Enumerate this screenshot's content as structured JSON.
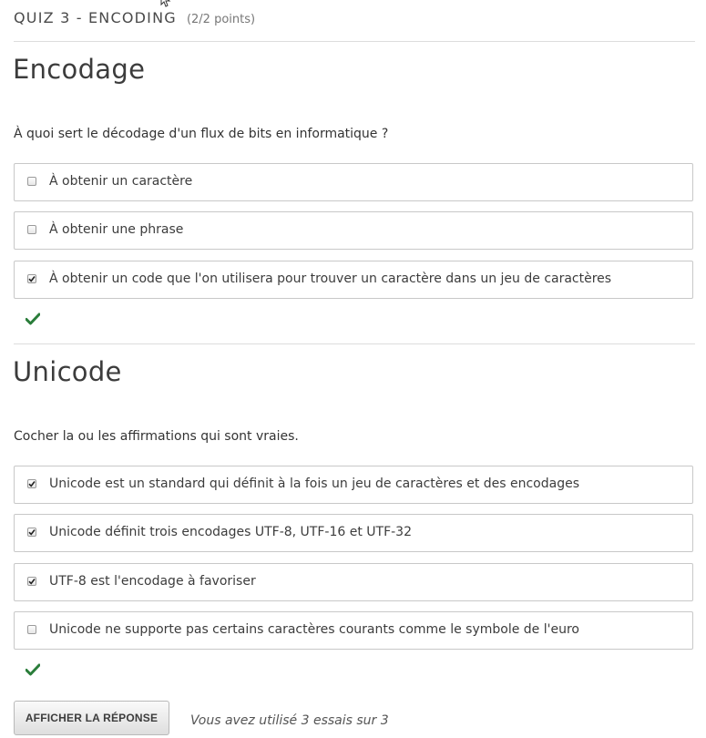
{
  "colors": {
    "correct": "#2a7d3a",
    "border": "#c8c8c8",
    "divider": "#dddddd"
  },
  "quiz": {
    "title": "QUIZ 3 - ENCODING",
    "points": "(2/2 points)"
  },
  "problems": [
    {
      "title": "Encodage",
      "question": "À quoi sert le décodage d'un flux de bits en informatique ?",
      "choices": [
        {
          "label": "À obtenir un caractère",
          "checked": false
        },
        {
          "label": "À obtenir une phrase",
          "checked": false
        },
        {
          "label": "À obtenir un code que l'on utilisera pour trouver un caractère dans un jeu de caractères",
          "checked": true
        }
      ],
      "status_icon": "checkmark-icon"
    },
    {
      "title": "Unicode",
      "question": "Cocher la ou les affirmations qui sont vraies.",
      "choices": [
        {
          "label": "Unicode est un standard qui définit à la fois un jeu de caractères et des encodages",
          "checked": true
        },
        {
          "label": "Unicode définit trois encodages UTF-8, UTF-16 et UTF-32",
          "checked": true
        },
        {
          "label": "UTF-8 est l'encodage à favoriser",
          "checked": true
        },
        {
          "label": "Unicode ne supporte pas certains caractères courants comme le symbole de l'euro",
          "checked": false
        }
      ],
      "status_icon": "checkmark-icon"
    }
  ],
  "actions": {
    "show_answer_label": "AFFICHER LA RÉPONSE",
    "attempts_text": "Vous avez utilisé 3 essais sur 3"
  }
}
